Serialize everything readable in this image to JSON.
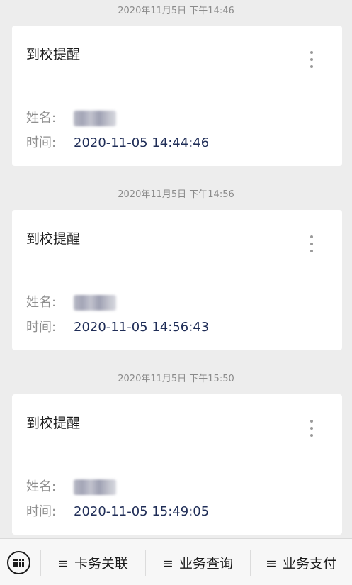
{
  "messages": [
    {
      "timestamp": "2020年11月5日 下午14:46",
      "title": "到校提醒",
      "name_label": "姓名:",
      "time_label": "时间:",
      "time_value": "2020-11-05 14:44:46"
    },
    {
      "timestamp": "2020年11月5日 下午14:56",
      "title": "到校提醒",
      "name_label": "姓名:",
      "time_label": "时间:",
      "time_value": "2020-11-05 14:56:43"
    },
    {
      "timestamp": "2020年11月5日 下午15:50",
      "title": "到校提醒",
      "name_label": "姓名:",
      "time_label": "时间:",
      "time_value": "2020-11-05 15:49:05"
    }
  ],
  "bottom_menu": {
    "keyboard_icon": "keyboard-icon",
    "menu_glyph": "≡",
    "items": [
      "卡务关联",
      "业务查询",
      "业务支付"
    ]
  }
}
